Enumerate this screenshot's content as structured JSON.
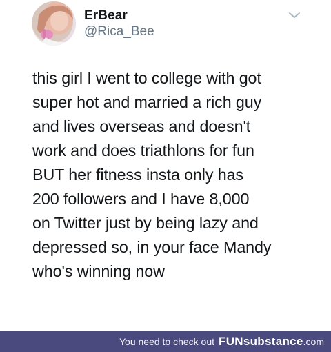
{
  "tweet": {
    "author": {
      "display_name": "ErBear",
      "handle": "@Rica_Bee",
      "avatar_icon": "profile-photo"
    },
    "menu_icon": "chevron-down-icon",
    "text": "this girl I went to college with got\nsuper hot and married a rich guy\nand lives overseas and doesn't\nwork and does triathlons for fun\nBUT her fitness insta only has\n200 followers and I have 8,000\non Twitter just by being lazy and\ndepressed so, in your face Mandy\nwho's winning now"
  },
  "footer": {
    "tagline": "You need to check out",
    "brand": "FUNsubstance",
    "domain": ".com",
    "background": "#4b4a7f"
  }
}
